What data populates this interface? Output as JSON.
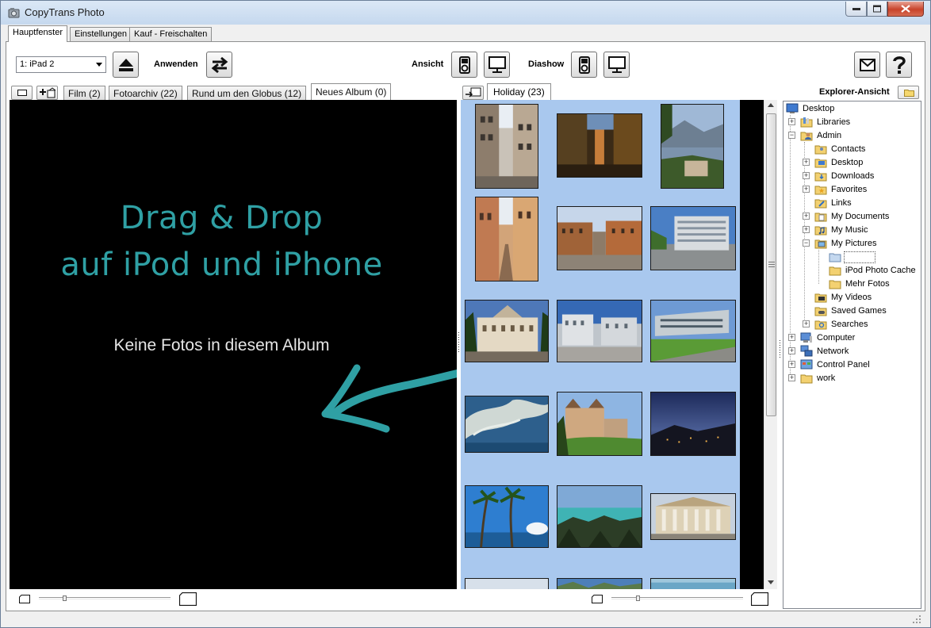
{
  "window": {
    "title": "CopyTrans Photo"
  },
  "main_tabs": [
    {
      "label": "Hauptfenster",
      "active": true
    },
    {
      "label": "Einstellungen",
      "active": false
    },
    {
      "label": "Kauf - Freischalten",
      "active": false
    }
  ],
  "toolbar": {
    "device_selected": "1: iPad 2",
    "apply_label": "Anwenden",
    "view_label": "Ansicht",
    "slideshow_label": "Diashow"
  },
  "device_albums": [
    {
      "label": "Film (2)"
    },
    {
      "label": "Fotoarchiv (22)"
    },
    {
      "label": "Rund um den Globus (12)"
    },
    {
      "label": "Neues Album (0)",
      "active": true
    }
  ],
  "drop_zone": {
    "line1": "Drag & Drop",
    "line2": "auf iPod und iPhone",
    "empty_message": "Keine Fotos in diesem Album",
    "accent_color": "#2fa0a4"
  },
  "pc_albums": [
    {
      "label": "Holiday (23)",
      "active": true
    }
  ],
  "explorer": {
    "label": "Explorer-Ansicht",
    "tree": [
      {
        "label": "Desktop",
        "level": 0,
        "icon": "desktop-icon"
      },
      {
        "label": "Libraries",
        "level": 1,
        "icon": "libraries-folder-icon",
        "expander": "+"
      },
      {
        "label": "Admin",
        "level": 1,
        "icon": "user-folder-icon",
        "expander": "-"
      },
      {
        "label": "Contacts",
        "level": 2,
        "icon": "folder-icon"
      },
      {
        "label": "Desktop",
        "level": 2,
        "icon": "folder-icon",
        "expander": "+"
      },
      {
        "label": "Downloads",
        "level": 2,
        "icon": "folder-icon",
        "expander": "+"
      },
      {
        "label": "Favorites",
        "level": 2,
        "icon": "folder-icon",
        "expander": "+"
      },
      {
        "label": "Links",
        "level": 2,
        "icon": "folder-icon"
      },
      {
        "label": "My Documents",
        "level": 2,
        "icon": "folder-icon",
        "expander": "+"
      },
      {
        "label": "My Music",
        "level": 2,
        "icon": "folder-icon",
        "expander": "+"
      },
      {
        "label": "My Pictures",
        "level": 2,
        "icon": "folder-icon",
        "expander": "-"
      },
      {
        "label": "",
        "level": 3,
        "icon": "folder-icon",
        "selected": true
      },
      {
        "label": "iPod Photo Cache",
        "level": 3,
        "icon": "folder-icon"
      },
      {
        "label": "Mehr Fotos",
        "level": 3,
        "icon": "folder-icon"
      },
      {
        "label": "My Videos",
        "level": 2,
        "icon": "folder-icon"
      },
      {
        "label": "Saved Games",
        "level": 2,
        "icon": "folder-icon"
      },
      {
        "label": "Searches",
        "level": 2,
        "icon": "folder-icon",
        "expander": "+"
      },
      {
        "label": "Computer",
        "level": 1,
        "icon": "computer-icon",
        "expander": "+"
      },
      {
        "label": "Network",
        "level": 1,
        "icon": "network-icon",
        "expander": "+"
      },
      {
        "label": "Control Panel",
        "level": 1,
        "icon": "control-panel-icon",
        "expander": "+"
      },
      {
        "label": "work",
        "level": 1,
        "icon": "folder-icon",
        "expander": "+"
      }
    ]
  }
}
